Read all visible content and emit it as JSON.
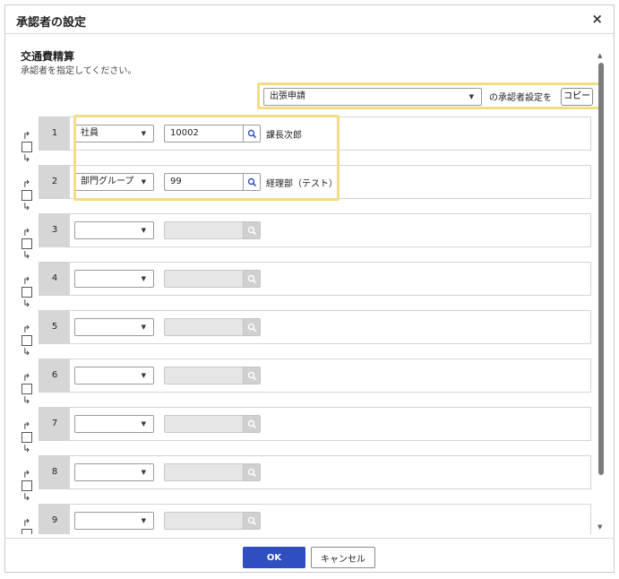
{
  "dialog": {
    "title": "承認者の設定",
    "close_icon": "×"
  },
  "section": {
    "title": "交通費精算",
    "description": "承認者を指定してください。"
  },
  "copy": {
    "selected": "出張申請",
    "text": "の承認者設定を",
    "button": "コピー"
  },
  "rows": [
    {
      "num": "1",
      "type": "社員",
      "code": "10002",
      "name": "課長次郎",
      "enabled": true
    },
    {
      "num": "2",
      "type": "部門グループ",
      "code": "99",
      "name": "経理部（テスト）",
      "enabled": true
    },
    {
      "num": "3",
      "type": "",
      "code": "",
      "name": "",
      "enabled": false
    },
    {
      "num": "4",
      "type": "",
      "code": "",
      "name": "",
      "enabled": false
    },
    {
      "num": "5",
      "type": "",
      "code": "",
      "name": "",
      "enabled": false
    },
    {
      "num": "6",
      "type": "",
      "code": "",
      "name": "",
      "enabled": false
    },
    {
      "num": "7",
      "type": "",
      "code": "",
      "name": "",
      "enabled": false
    },
    {
      "num": "8",
      "type": "",
      "code": "",
      "name": "",
      "enabled": false
    },
    {
      "num": "9",
      "type": "",
      "code": "",
      "name": "",
      "enabled": false
    }
  ],
  "footer": {
    "ok": "OK",
    "cancel": "キャンセル"
  },
  "icons": {
    "dropdown": "chevron-down-icon",
    "search": "search-icon",
    "insert_above": "arrow-turn-up-icon",
    "insert_below": "arrow-turn-down-icon"
  },
  "colors": {
    "ok_button": "#2f4fc0",
    "highlight": "#f4dc84",
    "row_number_bg": "#d6d6d6"
  }
}
